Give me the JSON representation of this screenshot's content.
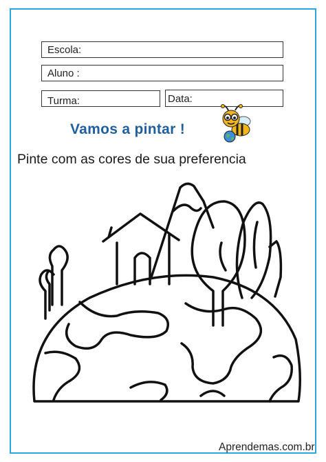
{
  "form": {
    "escola_label": "Escola:",
    "aluno_label": "Aluno :",
    "turma_label": "Turma:",
    "data_label": "Data:"
  },
  "title": "Vamos a pintar !",
  "instruction": "Pinte com as cores de sua preferencia",
  "footer": "Aprendemas.com.br",
  "colors": {
    "border": "#2aa9e0",
    "title": "#1f5f9e",
    "bee_body": "#f2b51c"
  },
  "icons": [
    "bee-icon"
  ]
}
